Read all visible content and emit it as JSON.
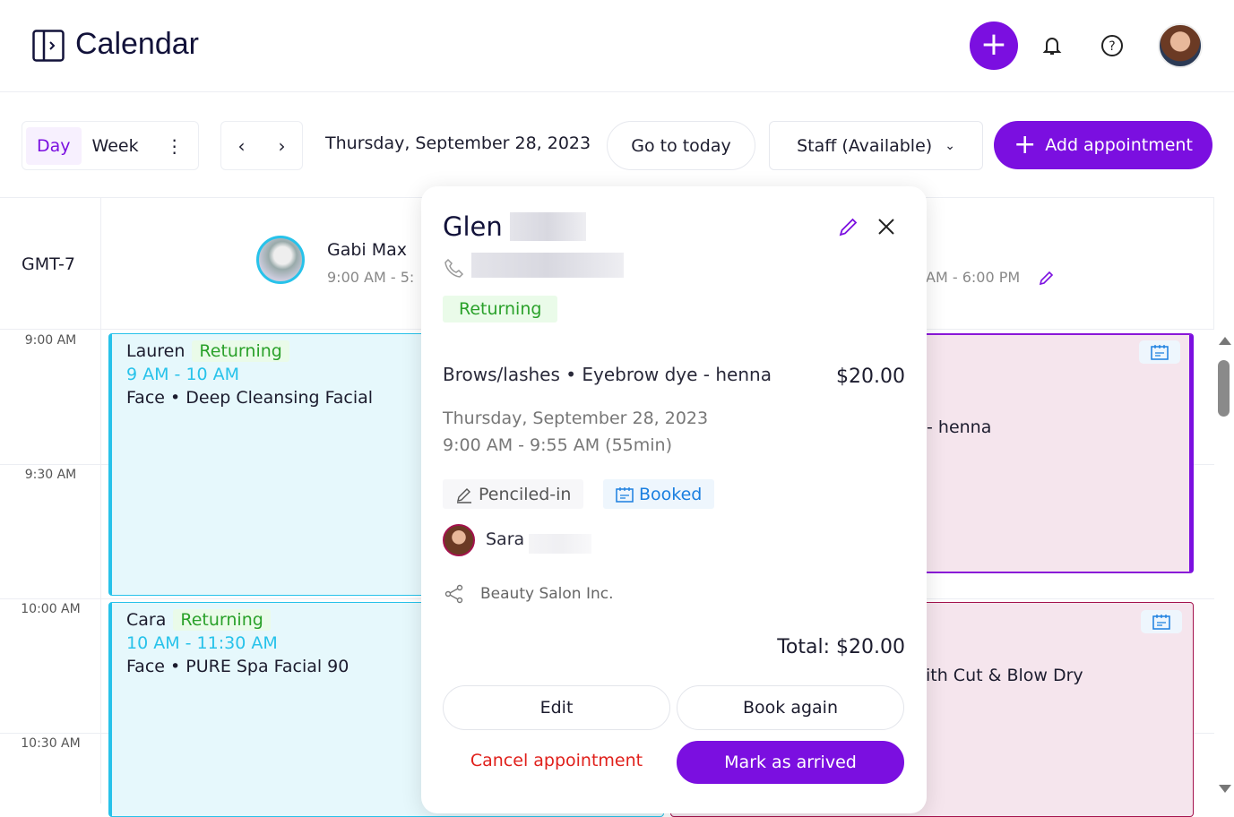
{
  "header": {
    "title": "Calendar",
    "icons": [
      "sidebar-toggle-icon",
      "plus-icon",
      "bell-icon",
      "help-icon",
      "avatar"
    ]
  },
  "toolbar": {
    "day": "Day",
    "week": "Week",
    "date": "Thursday, September 28, 2023",
    "go_today": "Go to today",
    "staff": "Staff (Available)",
    "add": "Add appointment"
  },
  "grid": {
    "timezone": "GMT-7",
    "times": [
      "9:00 AM",
      "9:30 AM",
      "10:00 AM",
      "10:30 AM"
    ],
    "staff": [
      {
        "name": "Gabi Max",
        "hours": "9:00 AM - 5:"
      },
      {
        "hours": "AM - 6:00 PM"
      }
    ]
  },
  "events": [
    {
      "client": "Lauren",
      "badge": "Returning",
      "time": "9 AM - 10 AM",
      "service": "Face • Deep Cleansing Facial"
    },
    {
      "client": "Cara",
      "badge": "Returning",
      "time": "10 AM - 11:30 AM",
      "service": "Face • PURE Spa Facial 90"
    },
    {
      "service": "- henna"
    },
    {
      "service": "ith Cut & Blow Dry"
    }
  ],
  "popup": {
    "client": "Glen",
    "badge": "Returning",
    "service": "Brows/lashes • Eyebrow dye - henna",
    "price": "$20.00",
    "date": "Thursday, September 28, 2023",
    "time": "9:00 AM - 9:55 AM (55min)",
    "penciled": "Penciled-in",
    "booked": "Booked",
    "staff": "Sara",
    "location": "Beauty Salon Inc.",
    "total": "Total: $20.00",
    "edit": "Edit",
    "book_again": "Book again",
    "cancel": "Cancel appointment",
    "arrived": "Mark as arrived"
  },
  "colors": {
    "accent": "#7b0fe0",
    "returning": "#2aa12a",
    "event_blue": "#27c2ea",
    "cancel": "#e0201b",
    "booked": "#1a7fe0"
  }
}
